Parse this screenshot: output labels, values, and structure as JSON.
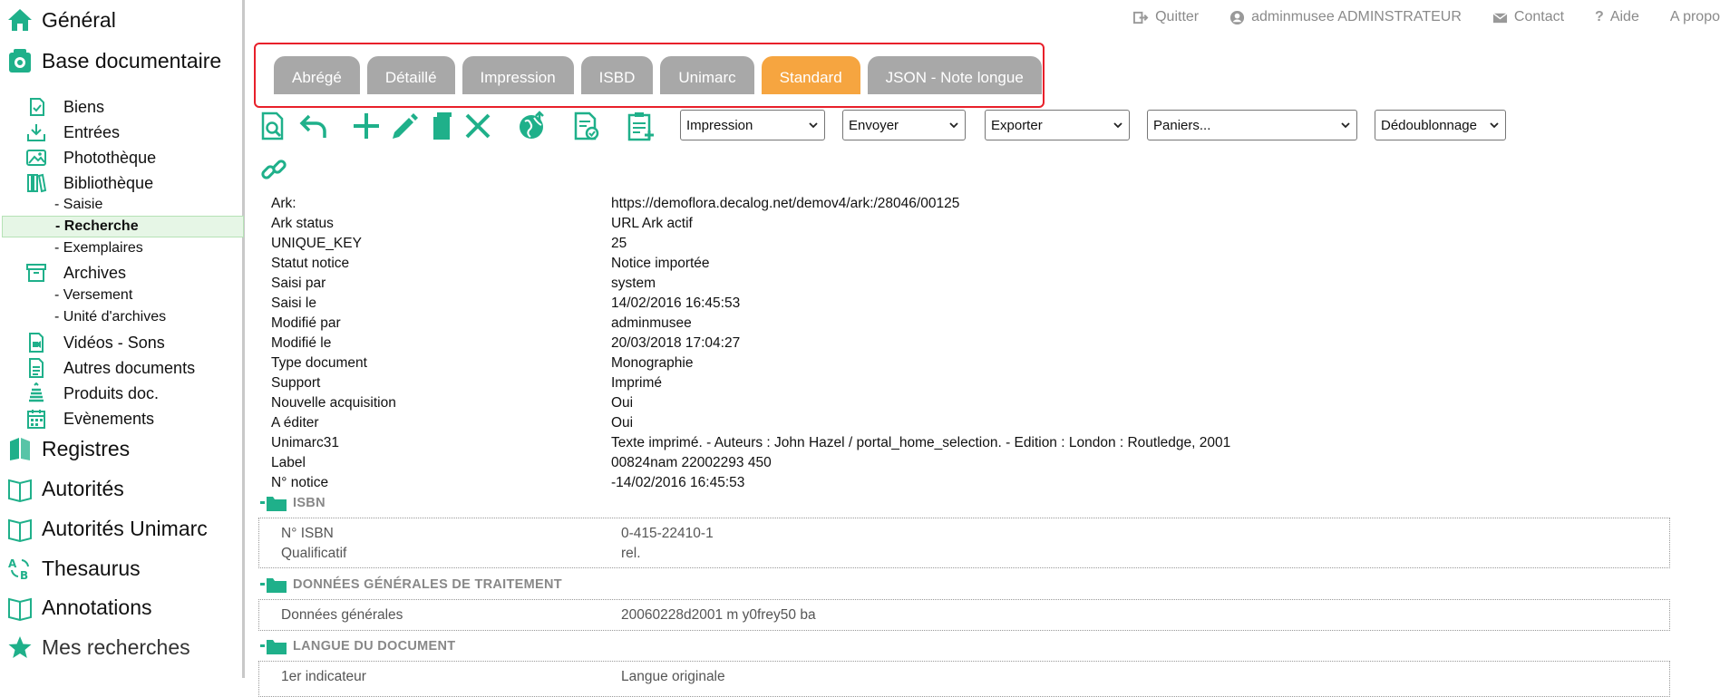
{
  "colors": {
    "brand_green": "#1fb08a",
    "tab_active": "#f6a540",
    "tab_inactive": "#a8a8a8",
    "highlight_border": "#e8202a"
  },
  "sidebar": {
    "general": "Général",
    "base_doc": "Base documentaire",
    "items": [
      {
        "label": "Biens",
        "icon": "biens-icon"
      },
      {
        "label": "Entrées",
        "icon": "inbox-download-icon"
      },
      {
        "label": "Photothèque",
        "icon": "photo-icon"
      },
      {
        "label": "Bibliothèque",
        "icon": "books-icon"
      }
    ],
    "biblio_leaves": [
      "- Saisie",
      "- Recherche",
      "- Exemplaires"
    ],
    "archives": "Archives",
    "archives_leaves": [
      "- Versement",
      "- Unité d'archives"
    ],
    "items2": [
      {
        "label": "Vidéos - Sons",
        "icon": "video-icon"
      },
      {
        "label": "Autres documents",
        "icon": "document-icon"
      },
      {
        "label": "Produits doc.",
        "icon": "stack-icon"
      },
      {
        "label": "Evènements",
        "icon": "calendar-icon"
      }
    ],
    "registres": "Registres",
    "autorites": "Autorités",
    "autorites_unimarc": "Autorités Unimarc",
    "thesaurus": "Thesaurus",
    "annotations": "Annotations",
    "mes_recherches": "Mes recherches"
  },
  "toplinks": {
    "quit": "Quitter",
    "user": "adminmusee ADMINSTRATEUR",
    "contact": "Contact",
    "help": "Aide",
    "about": "A propos"
  },
  "tabs": [
    "Abrégé",
    "Détaillé",
    "Impression",
    "ISBD",
    "Unimarc",
    "Standard",
    "JSON - Note longue"
  ],
  "active_tab": "Standard",
  "toolbar": {
    "selects": [
      "Impression",
      "Envoyer",
      "Exporter",
      "Paniers...",
      "Dédoublonnage"
    ]
  },
  "record": [
    {
      "k": "Ark:",
      "v": "https://demoflora.decalog.net/demov4/ark:/28046/00125"
    },
    {
      "k": "Ark status",
      "v": "URL Ark actif"
    },
    {
      "k": "UNIQUE_KEY",
      "v": "25"
    },
    {
      "k": "Statut notice",
      "v": "Notice importée"
    },
    {
      "k": "Saisi par",
      "v": "system"
    },
    {
      "k": "Saisi le",
      "v": "14/02/2016 16:45:53"
    },
    {
      "k": "Modifié par",
      "v": "adminmusee"
    },
    {
      "k": "Modifié le",
      "v": "20/03/2018 17:04:27"
    },
    {
      "k": "Type document",
      "v": "Monographie"
    },
    {
      "k": "Support",
      "v": "Imprimé"
    },
    {
      "k": "Nouvelle acquisition",
      "v": "Oui"
    },
    {
      "k": "A éditer",
      "v": "Oui"
    },
    {
      "k": "Unimarc31",
      "v": "Texte imprimé. - Auteurs : John Hazel / portal_home_selection. - Edition : London : Routledge, 2001"
    },
    {
      "k": "Label",
      "v": "00824nam 22002293 450"
    },
    {
      "k": "N° notice",
      "v": "-14/02/2016 16:45:53"
    }
  ],
  "sections": {
    "isbn": {
      "title": "ISBN",
      "rows": [
        {
          "k": "N° ISBN",
          "v": "0-415-22410-1"
        },
        {
          "k": "Qualificatif",
          "v": "rel."
        }
      ]
    },
    "donnees": {
      "title": "DONNÉES GÉNÉRALES DE TRAITEMENT",
      "rows": [
        {
          "k": "Données générales",
          "v": "20060228d2001 m y0frey50 ba"
        }
      ]
    },
    "langue": {
      "title": "LANGUE DU DOCUMENT",
      "rows": [
        {
          "k": "1er indicateur",
          "v": "Langue originale"
        }
      ]
    }
  }
}
